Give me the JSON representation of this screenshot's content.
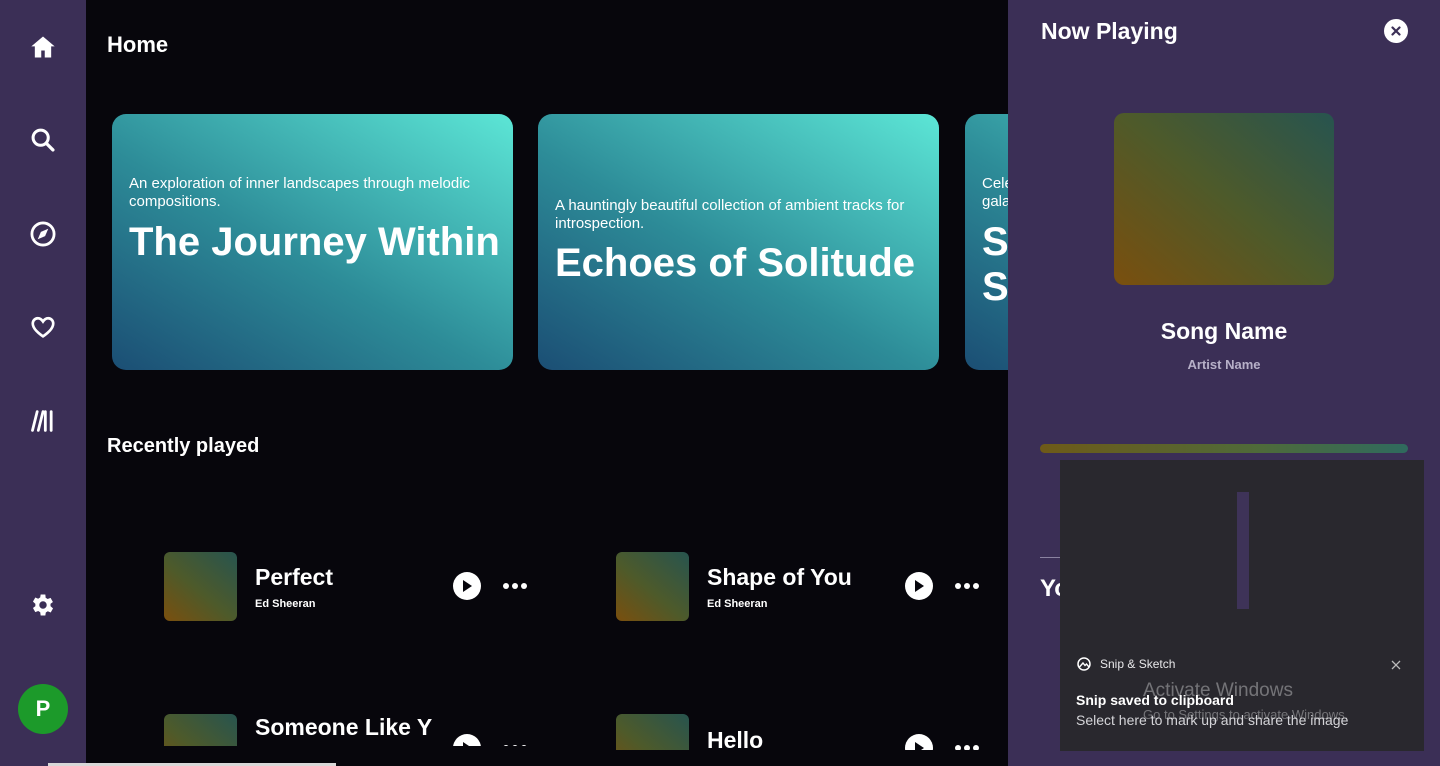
{
  "sidebar": {
    "items": [
      {
        "name": "home",
        "icon": "home-icon"
      },
      {
        "name": "search",
        "icon": "search-icon"
      },
      {
        "name": "explore",
        "icon": "compass-icon"
      },
      {
        "name": "favorites",
        "icon": "heart-icon"
      },
      {
        "name": "library",
        "icon": "library-icon"
      },
      {
        "name": "settings",
        "icon": "gear-icon"
      }
    ],
    "avatar_initial": "P",
    "avatar_color": "#1c9a2a"
  },
  "main": {
    "title": "Home",
    "cards": [
      {
        "description": "An exploration of inner landscapes through melodic compositions.",
        "title": "The Journey Within"
      },
      {
        "description": "A hauntingly beautiful collection of ambient tracks for introspection.",
        "title": "Echoes of Solitude"
      },
      {
        "description": "Cele gala",
        "title": "S S"
      }
    ],
    "recent_title": "Recently played",
    "recent": [
      {
        "name": "Perfect",
        "artist": "Ed Sheeran"
      },
      {
        "name": "Shape of You",
        "artist": "Ed Sheeran"
      },
      {
        "name": "Someone Like Y",
        "artist": ""
      },
      {
        "name": "Hello",
        "artist": ""
      }
    ]
  },
  "now_playing": {
    "title": "Now Playing",
    "song": "Song Name",
    "artist": "Artist Name",
    "next_label": "Yo"
  },
  "toast": {
    "app": "Snip & Sketch",
    "heading": "Snip saved to clipboard",
    "body": "Select here to mark up and share the image"
  },
  "watermark": {
    "line1": "Activate Windows",
    "line2": "Go to Settings to activate Windows."
  },
  "colors": {
    "sidebar_bg": "#3b2f56",
    "main_bg": "#07060c",
    "accent_card": "#2d8c98"
  }
}
